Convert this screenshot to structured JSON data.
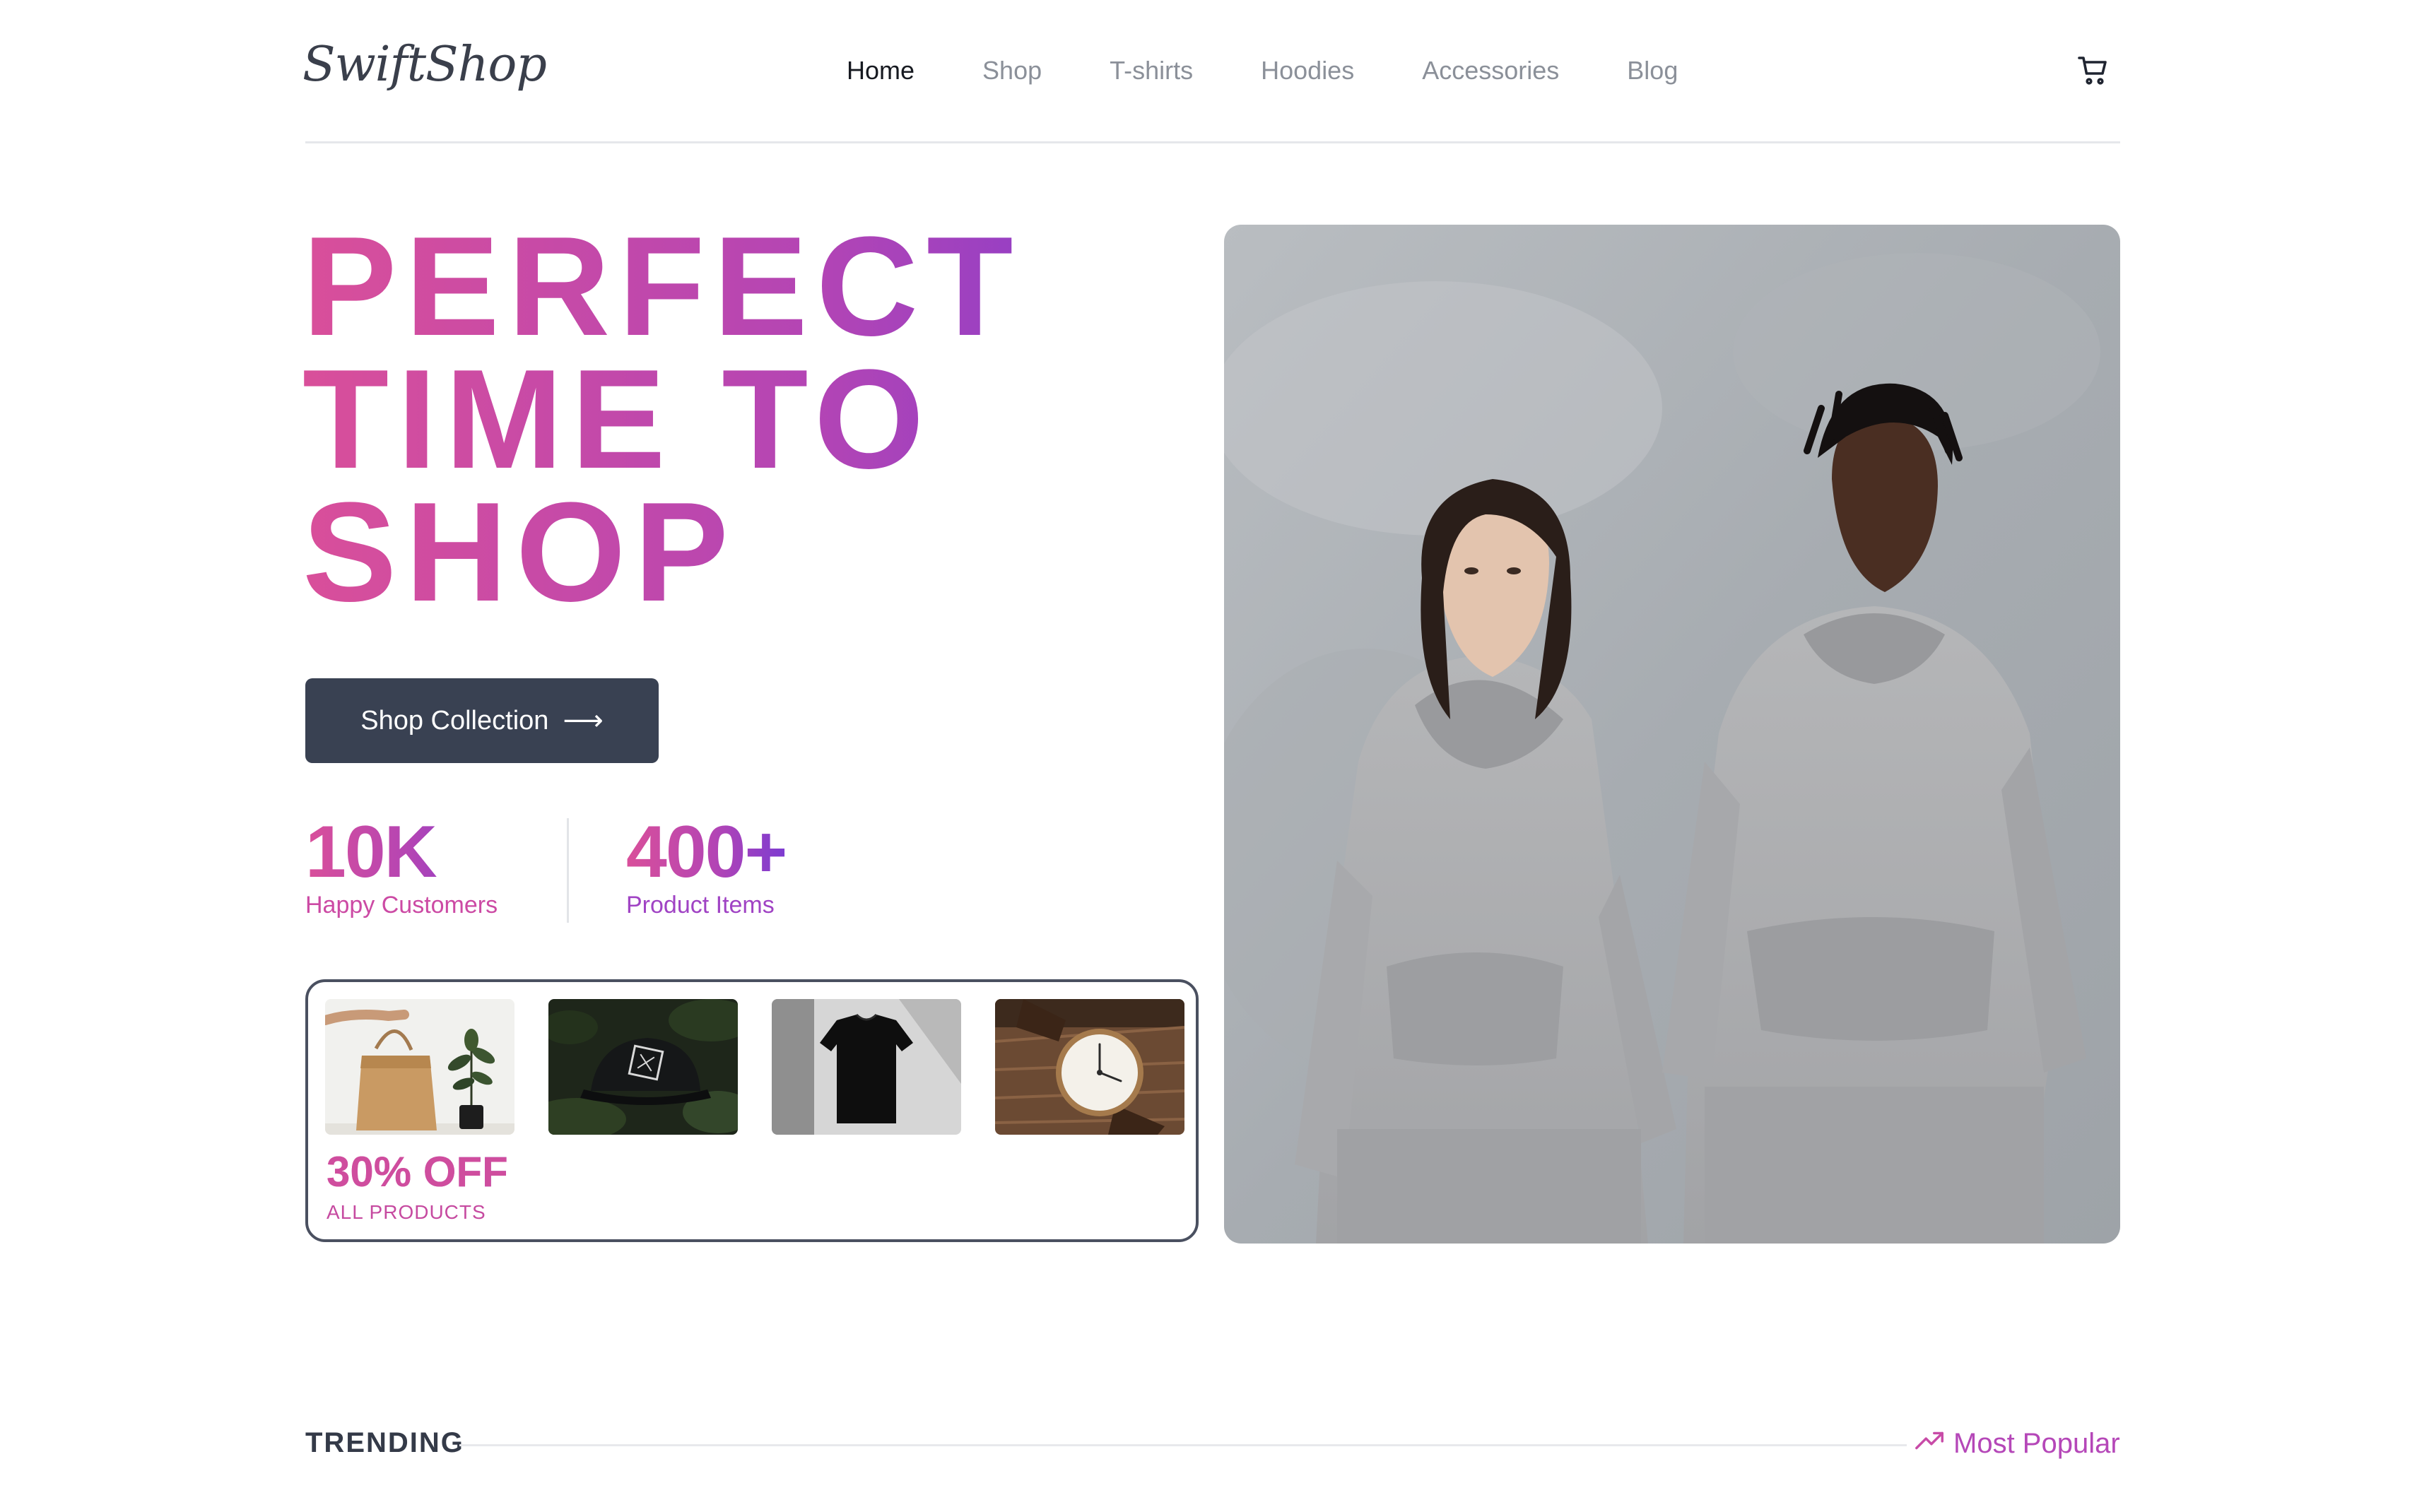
{
  "header": {
    "logo": "SwiftShop",
    "nav": [
      {
        "label": "Home",
        "active": true
      },
      {
        "label": "Shop",
        "active": false
      },
      {
        "label": "T-shirts",
        "active": false
      },
      {
        "label": "Hoodies",
        "active": false
      },
      {
        "label": "Accessories",
        "active": false
      },
      {
        "label": "Blog",
        "active": false
      }
    ],
    "cart_icon": "cart-icon"
  },
  "hero": {
    "title_lines": [
      "PERFECT",
      "TIME TO",
      "SHOP"
    ],
    "cta_label": "Shop Collection",
    "cta_icon": "arrow-right-icon",
    "stats": [
      {
        "value": "10K",
        "label": "Happy Customers"
      },
      {
        "value": "400+",
        "label": "Product Items"
      }
    ],
    "image": "models-in-grey-hoodies"
  },
  "promo": {
    "discount": "30% OFF",
    "subtitle": "ALL PRODUCTS",
    "thumbnails": [
      "tote-bag",
      "black-cap",
      "black-tshirt",
      "wristwatch"
    ]
  },
  "trending": {
    "label": "TRENDING",
    "link_label": "Most Popular",
    "link_icon": "trending-up-icon"
  },
  "colors": {
    "gradient_start": "#d94f9a",
    "gradient_end": "#7d3bd1",
    "button": "#394152",
    "text_dark": "#171a21",
    "nav_muted": "#8b9099"
  }
}
